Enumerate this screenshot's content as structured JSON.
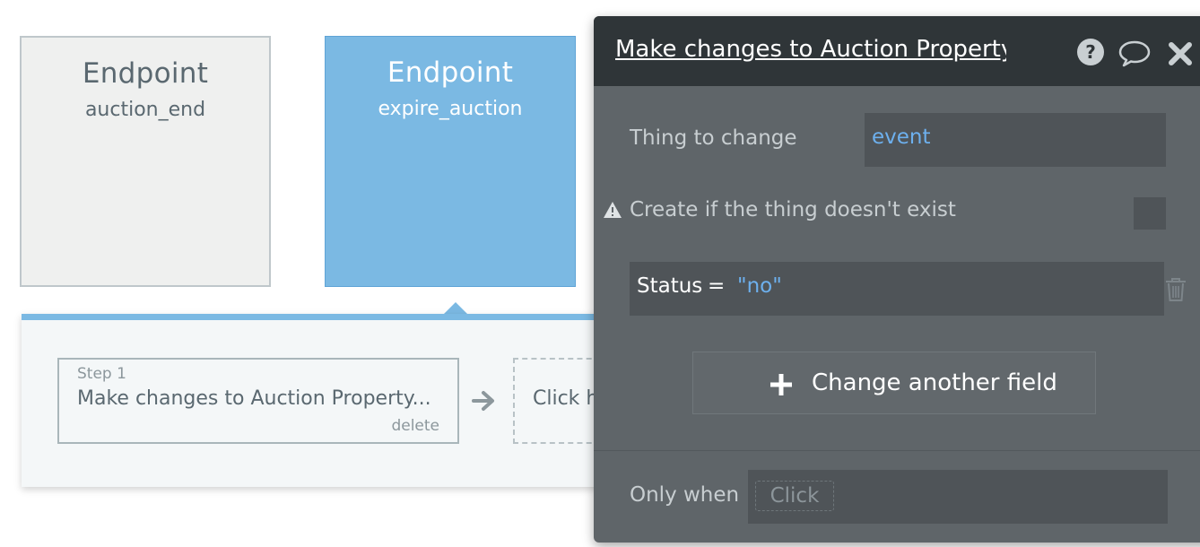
{
  "endpoints": [
    {
      "title": "Endpoint",
      "name": "auction_end"
    },
    {
      "title": "Endpoint",
      "name": "expire_auction"
    }
  ],
  "workflow": {
    "step": {
      "label": "Step 1",
      "action": "Make changes to Auction Property...",
      "delete_label": "delete"
    },
    "add_step_label": "Click h"
  },
  "editor": {
    "title": "Make changes to Auction Property",
    "thing_to_change_label": "Thing to change",
    "thing_to_change_value": "event",
    "create_if_missing_label": "Create if the thing doesn't exist",
    "field_assignment": {
      "field": "Status",
      "operator": "=",
      "value": "\"no\""
    },
    "change_another_label": "Change another field",
    "only_when_label": "Only when",
    "only_when_placeholder": "Click"
  },
  "icons": {
    "help": "question-circle-icon",
    "comment": "comment-bubble-icon",
    "close": "close-x-icon",
    "warning": "warning-triangle-icon",
    "trash": "trash-icon",
    "plus": "plus-icon",
    "arrow": "arrow-right-icon"
  },
  "colors": {
    "selected_endpoint": "#7bb9e3",
    "dynamic_value": "#6db0ee",
    "editor_bg": "#5f6569",
    "editor_header": "#2f3538"
  }
}
